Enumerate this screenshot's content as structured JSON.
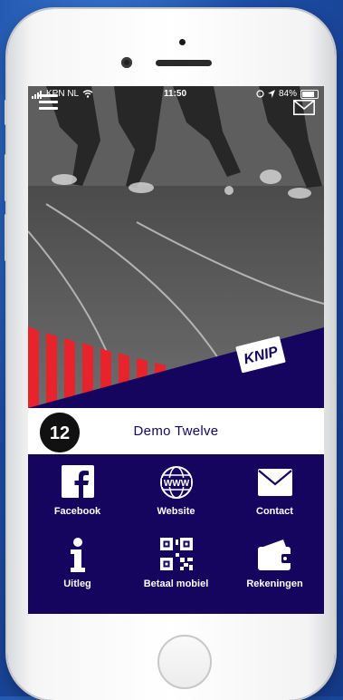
{
  "status": {
    "carrier": "KPN NL",
    "time": "11:50",
    "battery": "84%"
  },
  "brand": {
    "name": "Demo Twelve",
    "logo_text": "12",
    "ribbon_text": "KNIP"
  },
  "tiles": [
    {
      "label": "Facebook",
      "icon": "facebook-icon"
    },
    {
      "label": "Website",
      "icon": "globe-www-icon"
    },
    {
      "label": "Contact",
      "icon": "envelope-icon"
    },
    {
      "label": "Uitleg",
      "icon": "info-icon"
    },
    {
      "label": "Betaal mobiel",
      "icon": "qr-code-icon"
    },
    {
      "label": "Rekeningen",
      "icon": "wallet-icon"
    }
  ],
  "colors": {
    "primary": "#15055f",
    "accent_red": "#e8232b",
    "background_blue": "#1e4fa8"
  }
}
